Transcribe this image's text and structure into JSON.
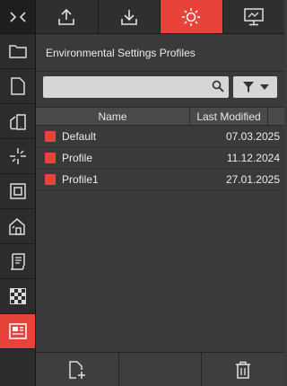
{
  "toolbar": {
    "buttons": [
      {
        "icon": "upload-icon"
      },
      {
        "icon": "download-icon"
      },
      {
        "icon": "sun-icon",
        "active": true
      },
      {
        "icon": "monitor-icon"
      }
    ],
    "accent_color": "#e8433a"
  },
  "sidebar": {
    "items": [
      {
        "icon": "folder-icon"
      },
      {
        "icon": "document-icon"
      },
      {
        "icon": "phone-device-icon"
      },
      {
        "icon": "sparkle-icon"
      },
      {
        "icon": "frame-icon"
      },
      {
        "icon": "house-icon"
      },
      {
        "icon": "script-icon"
      },
      {
        "icon": "checker-icon"
      },
      {
        "icon": "profile-card-icon",
        "active": true
      }
    ]
  },
  "main": {
    "title": "Environmental Settings Profiles",
    "search": {
      "value": "",
      "placeholder": ""
    },
    "table": {
      "headers": {
        "name": "Name",
        "modified": "Last Modified"
      },
      "rows": [
        {
          "name": "Default",
          "modified": "07.03.2025"
        },
        {
          "name": "Profile",
          "modified": "11.12.2024"
        },
        {
          "name": "Profile1",
          "modified": "27.01.2025"
        }
      ]
    }
  },
  "bottombar": {
    "buttons": [
      {
        "icon": "new-file-icon"
      },
      {
        "icon": "blank"
      },
      {
        "icon": "trash-icon"
      }
    ]
  }
}
